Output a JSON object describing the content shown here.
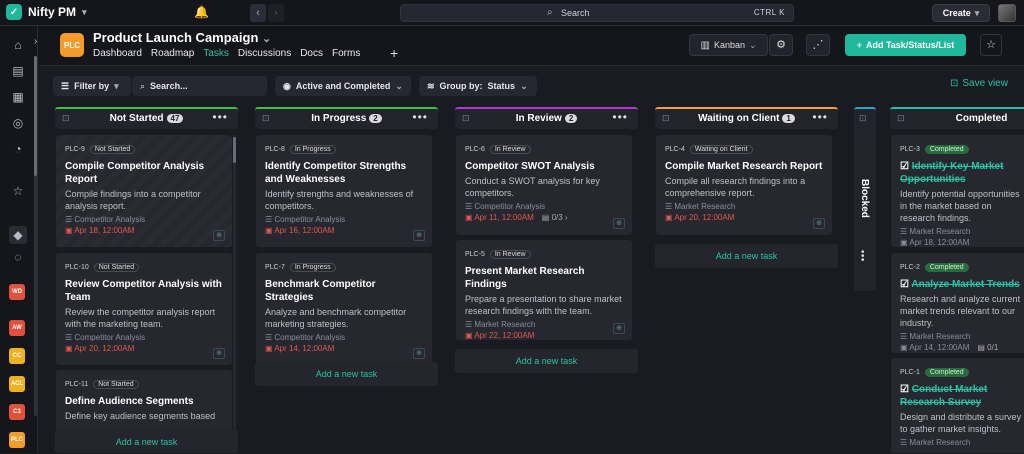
{
  "app": {
    "name": "Nifty PM"
  },
  "topbar": {
    "search_label": "Search",
    "search_shortcut": "CTRL K",
    "create_label": "Create"
  },
  "rail": {
    "badges": [
      {
        "text": "WD",
        "color": "#e0503c"
      },
      {
        "text": "AW",
        "color": "#e0503c"
      },
      {
        "text": "CC",
        "color": "#f0b020"
      },
      {
        "text": "ACL",
        "color": "#f0b020"
      },
      {
        "text": "C3",
        "color": "#e0503c"
      },
      {
        "text": "PLC",
        "color": "#f49b2a"
      }
    ]
  },
  "project": {
    "badge": "PLC",
    "title": "Product Launch Campaign",
    "tabs": [
      "Dashboard",
      "Roadmap",
      "Tasks",
      "Discussions",
      "Docs",
      "Forms"
    ],
    "active_tab": "Tasks",
    "view_label": "Kanban",
    "add_label": "Add Task/Status/List"
  },
  "filters": {
    "filter_by": "Filter by",
    "search_placeholder": "Search...",
    "active_completed": "Active and Completed",
    "group_by_label": "Group by:",
    "group_by_value": "Status",
    "save_view": "Save view"
  },
  "columns": [
    {
      "name": "Not Started",
      "count": "47",
      "color": "#38c24a",
      "add_label": "Add a new task",
      "cards": [
        {
          "id": "PLC-9",
          "status": "Not Started",
          "title": "Compile Competitor Analysis Report",
          "desc": "Compile findings into a competitor analysis report.",
          "category": "Competitor Analysis",
          "date": "Apr 18, 12:00AM"
        },
        {
          "id": "PLC-10",
          "status": "Not Started",
          "title": "Review Competitor Analysis with Team",
          "desc": "Review the competitor analysis report with the marketing team.",
          "category": "Competitor Analysis",
          "date": "Apr 20, 12:00AM"
        },
        {
          "id": "PLC-11",
          "status": "Not Started",
          "title": "Define Audience Segments",
          "desc": "Define key audience segments based",
          "category": "",
          "date": ""
        }
      ]
    },
    {
      "name": "In Progress",
      "count": "2",
      "color": "#38c24a",
      "add_label": "Add a new task",
      "cards": [
        {
          "id": "PLC-8",
          "status": "In Progress",
          "title": "Identify Competitor Strengths and Weaknesses",
          "desc": "Identify strengths and weaknesses of competitors.",
          "category": "Competitor Analysis",
          "date": "Apr 16, 12:00AM"
        },
        {
          "id": "PLC-7",
          "status": "In Progress",
          "title": "Benchmark Competitor Strategies",
          "desc": "Analyze and benchmark competitor marketing strategies.",
          "category": "Competitor Analysis",
          "date": "Apr 14, 12:00AM"
        }
      ]
    },
    {
      "name": "In Review",
      "count": "2",
      "color": "#b038d0",
      "add_label": "Add a new task",
      "cards": [
        {
          "id": "PLC-6",
          "status": "In Review",
          "title": "Competitor SWOT Analysis",
          "desc": "Conduct a SWOT analysis for key competitors.",
          "category": "Competitor Analysis",
          "date": "Apr 11, 12:00AM",
          "subtasks": "0/3"
        },
        {
          "id": "PLC-5",
          "status": "In Review",
          "title": "Present Market Research Findings",
          "desc": "Prepare a presentation to share market research findings with the team.",
          "category": "Market Research",
          "date": "Apr 22, 12:00AM"
        }
      ]
    },
    {
      "name": "Waiting on Client",
      "count": "1",
      "color": "#f0a040",
      "add_label": "Add a new task",
      "cards": [
        {
          "id": "PLC-4",
          "status": "Waiting on Client",
          "title": "Compile Market Research Report",
          "desc": "Compile all research findings into a comprehensive report.",
          "category": "Market Research",
          "date": "Apr 20, 12:00AM"
        }
      ]
    },
    {
      "name": "Completed",
      "count": "",
      "color": "#1fc0a8",
      "cards": [
        {
          "id": "PLC-3",
          "status": "Completed",
          "title": "Identify Key Market Opportunities",
          "desc": "Identify potential opportunities in the market based on research findings.",
          "category": "Market Research",
          "date": "Apr 18, 12:00AM"
        },
        {
          "id": "PLC-2",
          "status": "Completed",
          "title": "Analyze Market Trends",
          "desc": "Research and analyze current market trends relevant to our industry.",
          "category": "Market Research",
          "date": "Apr 14, 12:00AM",
          "subtasks": "0/1"
        },
        {
          "id": "PLC-1",
          "status": "Completed",
          "title": "Conduct Market Research Survey",
          "desc": "Design and distribute a survey to gather market insights.",
          "category": "Market Research",
          "date": ""
        }
      ]
    }
  ],
  "blocked": {
    "name": "Blocked"
  }
}
